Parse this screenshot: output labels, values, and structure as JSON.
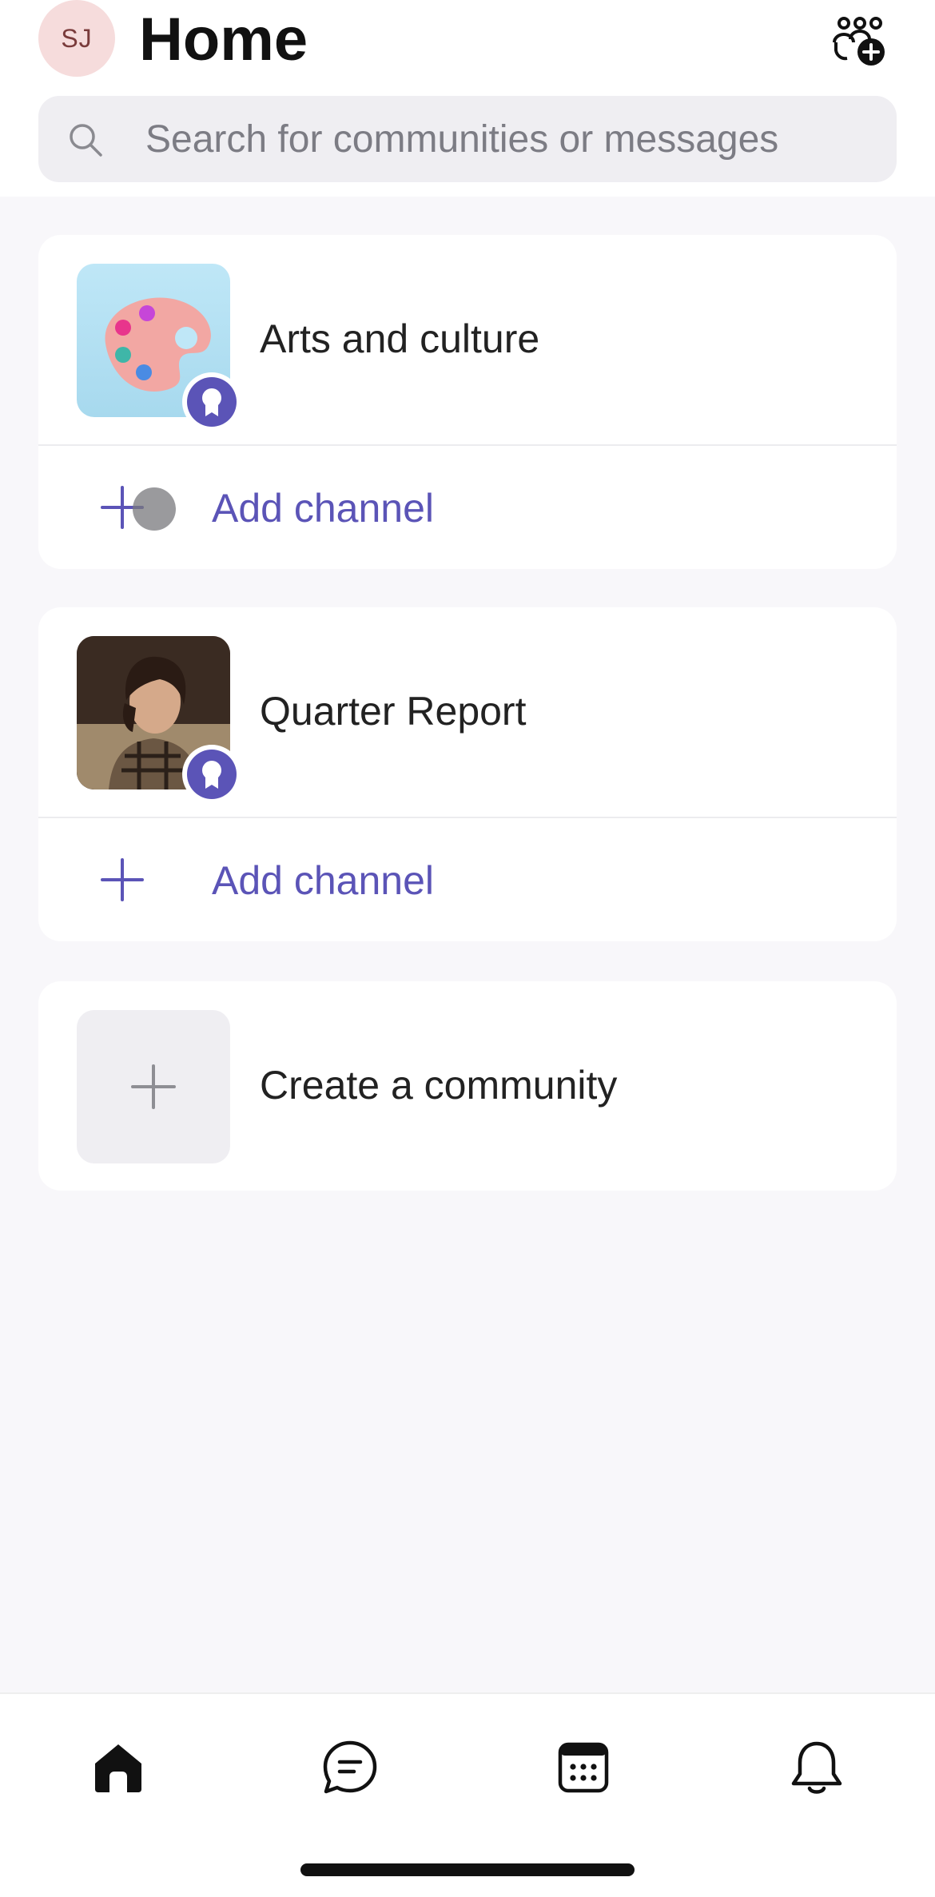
{
  "header": {
    "avatar_initials": "SJ",
    "title": "Home",
    "new_community_icon": "people-add-icon"
  },
  "search": {
    "placeholder": "Search for communities or messages",
    "icon": "search-icon"
  },
  "communities": [
    {
      "name": "Arts and culture",
      "thumbnail_icon": "palette-icon",
      "badge_icon": "award-ribbon-icon",
      "add_channel_label": "Add channel"
    },
    {
      "name": "Quarter Report",
      "thumbnail_icon": "portrait-photo",
      "badge_icon": "award-ribbon-icon",
      "add_channel_label": "Add channel"
    }
  ],
  "create": {
    "label": "Create a community",
    "icon": "plus-icon"
  },
  "tabbar": {
    "items": [
      {
        "icon": "home-icon",
        "active": true
      },
      {
        "icon": "chat-icon",
        "active": false
      },
      {
        "icon": "calendar-icon",
        "active": false
      },
      {
        "icon": "bell-icon",
        "active": false
      }
    ]
  },
  "colors": {
    "accent": "#5b54b7",
    "background": "#f8f7fa",
    "card": "#ffffff",
    "avatar_bg": "#f6dcdc"
  }
}
